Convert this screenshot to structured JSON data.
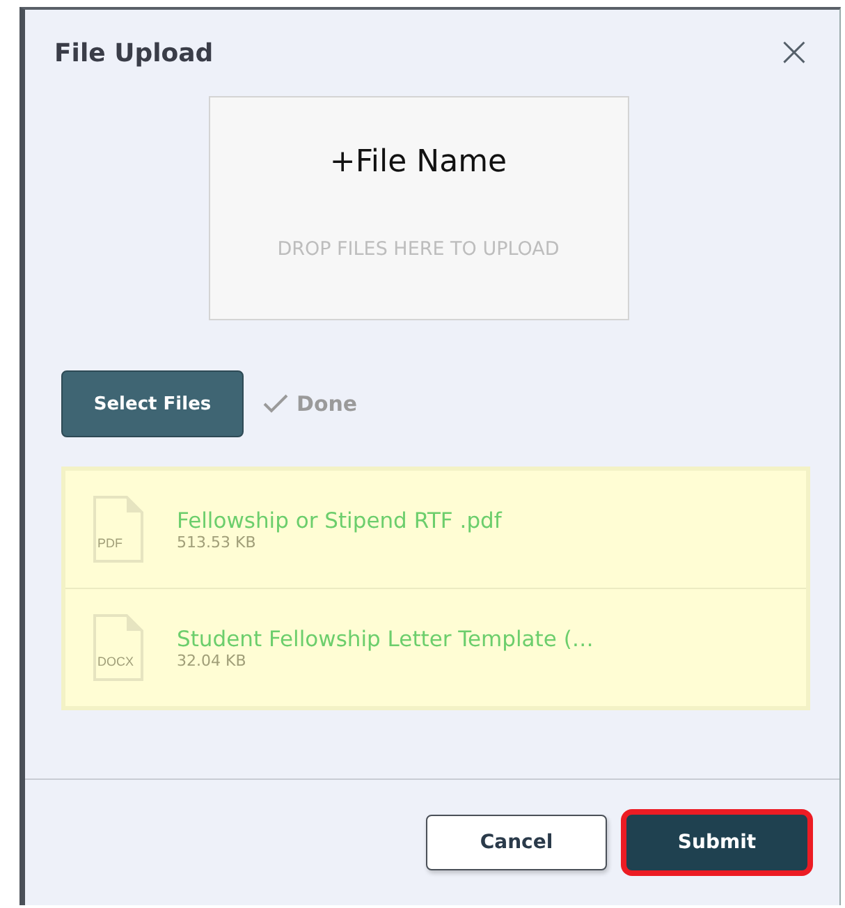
{
  "dialog": {
    "title": "File Upload",
    "close": "×"
  },
  "dropzone": {
    "title": "+File Name",
    "hint": "DROP FILES HERE TO UPLOAD"
  },
  "select_button": "Select Files",
  "status": {
    "label": "Done",
    "done": true
  },
  "files": [
    {
      "type": "PDF",
      "name": "Fellowship or Stipend RTF .pdf",
      "size": "513.53 KB"
    },
    {
      "type": "DOCX",
      "name": "Student Fellowship Letter Template (…",
      "size": "32.04 KB"
    }
  ],
  "buttons": [
    {
      "kind": "secondary",
      "label": "Cancel",
      "highlighted": false
    },
    {
      "kind": "primary",
      "label": "Submit",
      "highlighted": true
    }
  ]
}
